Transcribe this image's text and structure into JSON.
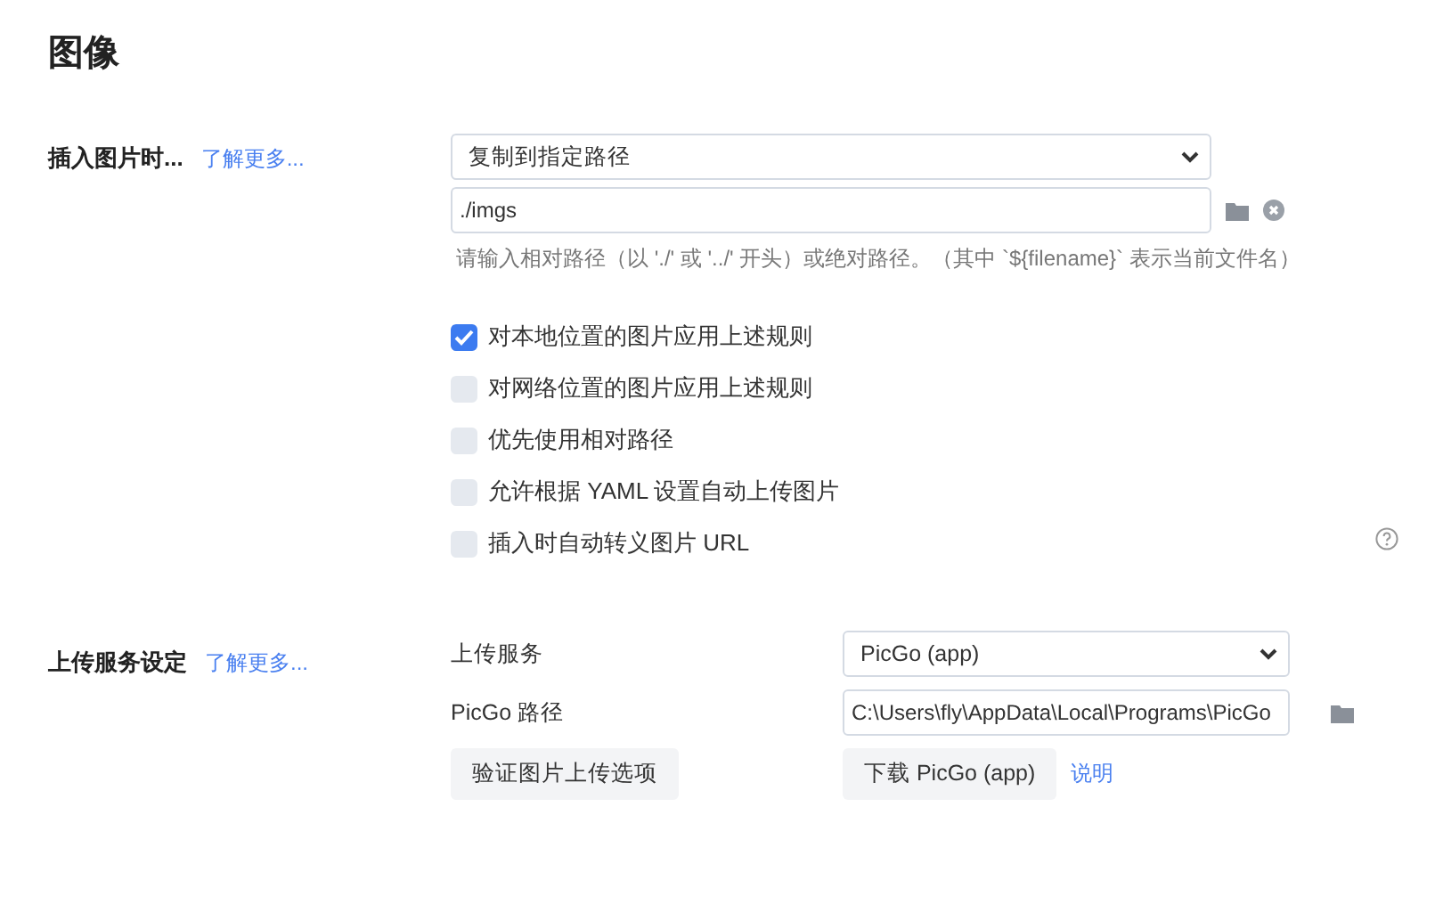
{
  "title": "图像",
  "insert_section": {
    "label": "插入图片时...",
    "learn_more": "了解更多...",
    "action_select": "复制到指定路径",
    "path_value": "./imgs",
    "hint": "请输入相对路径（以 './' 或 '../' 开头）或绝对路径。（其中 `${filename}` 表示当前文件名）",
    "options": [
      {
        "label": "对本地位置的图片应用上述规则",
        "checked": true
      },
      {
        "label": "对网络位置的图片应用上述规则",
        "checked": false
      },
      {
        "label": "优先使用相对路径",
        "checked": false
      },
      {
        "label": "允许根据 YAML 设置自动上传图片",
        "checked": false
      },
      {
        "label": "插入时自动转义图片 URL",
        "checked": false
      }
    ]
  },
  "upload_section": {
    "label": "上传服务设定",
    "learn_more": "了解更多...",
    "service_label": "上传服务",
    "service_select": "PicGo (app)",
    "path_label": "PicGo 路径",
    "path_value": "C:\\Users\\fly\\AppData\\Local\\Programs\\PicGo",
    "verify_button": "验证图片上传选项",
    "download_button": "下载 PicGo (app)",
    "help_link": "说明"
  }
}
